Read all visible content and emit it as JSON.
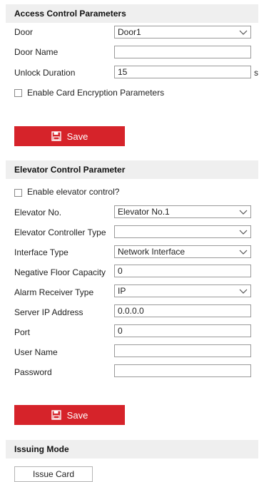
{
  "access": {
    "title": "Access Control Parameters",
    "door_label": "Door",
    "door_value": "Door1",
    "door_name_label": "Door Name",
    "door_name_value": "",
    "unlock_label": "Unlock Duration",
    "unlock_value": "15",
    "unlock_unit": "s",
    "encryption_label": "Enable Card Encryption Parameters",
    "encryption_checked": false,
    "save_label": "Save"
  },
  "elevator": {
    "title": "Elevator Control Parameter",
    "enable_label": "Enable elevator control?",
    "enable_checked": false,
    "no_label": "Elevator No.",
    "no_value": "Elevator No.1",
    "controller_type_label": "Elevator Controller Type",
    "controller_type_value": "",
    "interface_label": "Interface Type",
    "interface_value": "Network Interface",
    "neg_floor_label": "Negative Floor Capacity",
    "neg_floor_value": "0",
    "alarm_receiver_label": "Alarm Receiver Type",
    "alarm_receiver_value": "IP",
    "server_ip_label": "Server IP Address",
    "server_ip_value": "0.0.0.0",
    "port_label": "Port",
    "port_value": "0",
    "username_label": "User Name",
    "username_value": "",
    "password_label": "Password",
    "password_value": "",
    "save_label": "Save"
  },
  "issuing": {
    "title": "Issuing Mode",
    "button_label": "Issue Card"
  },
  "colors": {
    "accent": "#d6232a",
    "header_bg": "#efefef",
    "border": "#9a9a9a"
  },
  "icons": {
    "save": "floppy-disk-icon",
    "dropdown": "chevron-down-icon"
  }
}
